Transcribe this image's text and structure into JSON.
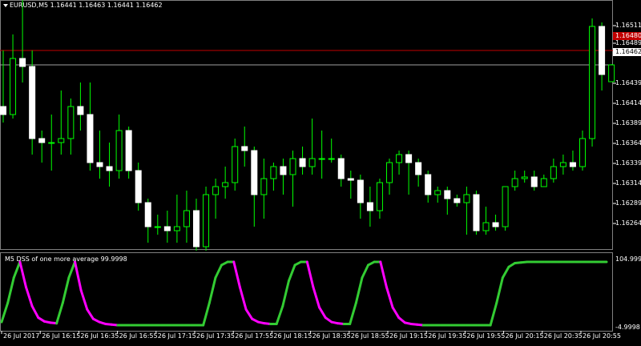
{
  "header": {
    "symbol": "EURUSD,M5",
    "ohlc": "1.16441 1.16463 1.16441 1.16462"
  },
  "price_axis": {
    "labels": [
      "1.16511",
      "1.16489",
      "1.16439",
      "1.16414",
      "1.16389",
      "1.16364",
      "1.16339",
      "1.16314",
      "1.16289",
      "1.16264"
    ],
    "red_level": "1.16480",
    "bid": "1.16462"
  },
  "indicator": {
    "title": "M5 DSS of one more average 99.9998",
    "max_label": "104.9998",
    "min_label": "-4.9998"
  },
  "time_axis": {
    "labels": [
      "26 Jul 2017",
      "26 Jul 16:15",
      "26 Jul 16:35",
      "26 Jul 16:55",
      "26 Jul 17:15",
      "26 Jul 17:35",
      "26 Jul 17:55",
      "26 Jul 18:15",
      "26 Jul 18:35",
      "26 Jul 18:55",
      "26 Jul 19:15",
      "26 Jul 19:35",
      "26 Jul 19:55",
      "26 Jul 20:15",
      "26 Jul 20:35",
      "26 Jul 20:55"
    ]
  },
  "colors": {
    "background": "#000000",
    "bull": "#00ff00",
    "bear_body": "#ffffff",
    "red_line": "#c00000",
    "dss_up": "#33cc33",
    "dss_down": "#ff00ff",
    "grid": "#808080"
  },
  "chart_data": [
    {
      "type": "candlestick",
      "title": "EURUSD,M5",
      "y_ticks": [
        1.16511,
        1.16489,
        1.16439,
        1.16414,
        1.16389,
        1.16364,
        1.16339,
        1.16314,
        1.16289,
        1.16264
      ],
      "levels": {
        "red": 1.1648,
        "bid": 1.16462
      },
      "candles": [
        {
          "o": 1.1641,
          "h": 1.1648,
          "l": 1.1639,
          "c": 1.164
        },
        {
          "o": 1.164,
          "h": 1.165,
          "l": 1.16395,
          "c": 1.1647
        },
        {
          "o": 1.1647,
          "h": 1.1656,
          "l": 1.1644,
          "c": 1.1646
        },
        {
          "o": 1.1646,
          "h": 1.1648,
          "l": 1.1635,
          "c": 1.1637
        },
        {
          "o": 1.1637,
          "h": 1.1638,
          "l": 1.1634,
          "c": 1.16365
        },
        {
          "o": 1.16365,
          "h": 1.164,
          "l": 1.1633,
          "c": 1.16365
        },
        {
          "o": 1.16365,
          "h": 1.1643,
          "l": 1.1635,
          "c": 1.1637
        },
        {
          "o": 1.1637,
          "h": 1.1642,
          "l": 1.1635,
          "c": 1.1641
        },
        {
          "o": 1.1641,
          "h": 1.1644,
          "l": 1.1638,
          "c": 1.164
        },
        {
          "o": 1.164,
          "h": 1.1644,
          "l": 1.1633,
          "c": 1.1634
        },
        {
          "o": 1.1634,
          "h": 1.1638,
          "l": 1.1632,
          "c": 1.16335
        },
        {
          "o": 1.16335,
          "h": 1.16365,
          "l": 1.1631,
          "c": 1.1633
        },
        {
          "o": 1.1633,
          "h": 1.164,
          "l": 1.1632,
          "c": 1.1638
        },
        {
          "o": 1.1638,
          "h": 1.16385,
          "l": 1.1632,
          "c": 1.1633
        },
        {
          "o": 1.1633,
          "h": 1.1634,
          "l": 1.1628,
          "c": 1.1629
        },
        {
          "o": 1.1629,
          "h": 1.16295,
          "l": 1.1624,
          "c": 1.1626
        },
        {
          "o": 1.1626,
          "h": 1.16275,
          "l": 1.1625,
          "c": 1.1626
        },
        {
          "o": 1.1626,
          "h": 1.1628,
          "l": 1.1624,
          "c": 1.16255
        },
        {
          "o": 1.16255,
          "h": 1.163,
          "l": 1.1624,
          "c": 1.1626
        },
        {
          "o": 1.1626,
          "h": 1.16305,
          "l": 1.1624,
          "c": 1.1628
        },
        {
          "o": 1.1628,
          "h": 1.16295,
          "l": 1.1623,
          "c": 1.16235
        },
        {
          "o": 1.16235,
          "h": 1.1631,
          "l": 1.1623,
          "c": 1.163
        },
        {
          "o": 1.163,
          "h": 1.1632,
          "l": 1.1627,
          "c": 1.1631
        },
        {
          "o": 1.1631,
          "h": 1.16335,
          "l": 1.16295,
          "c": 1.16315
        },
        {
          "o": 1.16315,
          "h": 1.1637,
          "l": 1.16305,
          "c": 1.1636
        },
        {
          "o": 1.1636,
          "h": 1.16385,
          "l": 1.16335,
          "c": 1.16355
        },
        {
          "o": 1.16355,
          "h": 1.1636,
          "l": 1.1626,
          "c": 1.163
        },
        {
          "o": 1.163,
          "h": 1.16345,
          "l": 1.1627,
          "c": 1.1632
        },
        {
          "o": 1.1632,
          "h": 1.1634,
          "l": 1.16305,
          "c": 1.16335
        },
        {
          "o": 1.16335,
          "h": 1.16345,
          "l": 1.163,
          "c": 1.16325
        },
        {
          "o": 1.16325,
          "h": 1.16355,
          "l": 1.16285,
          "c": 1.16345
        },
        {
          "o": 1.16345,
          "h": 1.1636,
          "l": 1.16325,
          "c": 1.16335
        },
        {
          "o": 1.16335,
          "h": 1.16395,
          "l": 1.16325,
          "c": 1.16345
        },
        {
          "o": 1.16345,
          "h": 1.1638,
          "l": 1.1632,
          "c": 1.16345
        },
        {
          "o": 1.16345,
          "h": 1.1637,
          "l": 1.1634,
          "c": 1.16345
        },
        {
          "o": 1.16345,
          "h": 1.1635,
          "l": 1.1631,
          "c": 1.1632
        },
        {
          "o": 1.1632,
          "h": 1.1633,
          "l": 1.16295,
          "c": 1.16318
        },
        {
          "o": 1.16318,
          "h": 1.16325,
          "l": 1.1627,
          "c": 1.1629
        },
        {
          "o": 1.1629,
          "h": 1.1631,
          "l": 1.1626,
          "c": 1.1628
        },
        {
          "o": 1.1628,
          "h": 1.1632,
          "l": 1.1627,
          "c": 1.16315
        },
        {
          "o": 1.16315,
          "h": 1.16345,
          "l": 1.163,
          "c": 1.1634
        },
        {
          "o": 1.1634,
          "h": 1.16355,
          "l": 1.16325,
          "c": 1.1635
        },
        {
          "o": 1.1635,
          "h": 1.16355,
          "l": 1.163,
          "c": 1.1634
        },
        {
          "o": 1.1634,
          "h": 1.16345,
          "l": 1.1631,
          "c": 1.16325
        },
        {
          "o": 1.16325,
          "h": 1.1633,
          "l": 1.1629,
          "c": 1.163
        },
        {
          "o": 1.163,
          "h": 1.1631,
          "l": 1.1629,
          "c": 1.16305
        },
        {
          "o": 1.16305,
          "h": 1.1631,
          "l": 1.16275,
          "c": 1.16295
        },
        {
          "o": 1.16295,
          "h": 1.163,
          "l": 1.16285,
          "c": 1.1629
        },
        {
          "o": 1.1629,
          "h": 1.1631,
          "l": 1.1625,
          "c": 1.163
        },
        {
          "o": 1.163,
          "h": 1.16305,
          "l": 1.1625,
          "c": 1.16255
        },
        {
          "o": 1.16255,
          "h": 1.16285,
          "l": 1.1625,
          "c": 1.16265
        },
        {
          "o": 1.16265,
          "h": 1.16275,
          "l": 1.16255,
          "c": 1.1626
        },
        {
          "o": 1.1626,
          "h": 1.1631,
          "l": 1.16255,
          "c": 1.1631
        },
        {
          "o": 1.1631,
          "h": 1.1633,
          "l": 1.16305,
          "c": 1.1632
        },
        {
          "o": 1.1632,
          "h": 1.1633,
          "l": 1.16315,
          "c": 1.16322
        },
        {
          "o": 1.16322,
          "h": 1.1633,
          "l": 1.16305,
          "c": 1.1631
        },
        {
          "o": 1.1631,
          "h": 1.16325,
          "l": 1.1631,
          "c": 1.1632
        },
        {
          "o": 1.1632,
          "h": 1.16345,
          "l": 1.16315,
          "c": 1.16335
        },
        {
          "o": 1.16335,
          "h": 1.1635,
          "l": 1.16325,
          "c": 1.1634
        },
        {
          "o": 1.1634,
          "h": 1.16355,
          "l": 1.1633,
          "c": 1.16335
        },
        {
          "o": 1.16335,
          "h": 1.1638,
          "l": 1.1633,
          "c": 1.1637
        },
        {
          "o": 1.1637,
          "h": 1.1652,
          "l": 1.1636,
          "c": 1.1651
        },
        {
          "o": 1.1651,
          "h": 1.16515,
          "l": 1.1643,
          "c": 1.1645
        },
        {
          "o": 1.16441,
          "h": 1.16463,
          "l": 1.16441,
          "c": 1.16462
        }
      ]
    },
    {
      "type": "line",
      "title": "M5 DSS of one more average 99.9998",
      "ylim": [
        -4.9998,
        104.9998
      ],
      "values": [
        5,
        35,
        75,
        100,
        60,
        30,
        12,
        6,
        4,
        3,
        35,
        75,
        100,
        55,
        25,
        10,
        5,
        2,
        1,
        0,
        0,
        0,
        0,
        0,
        0,
        0,
        0,
        0,
        0,
        0,
        0,
        0,
        0,
        0,
        35,
        75,
        95,
        100,
        100,
        60,
        25,
        10,
        5,
        3,
        2,
        2,
        30,
        70,
        95,
        100,
        100,
        60,
        28,
        12,
        5,
        3,
        2,
        2,
        35,
        75,
        95,
        100,
        100,
        60,
        28,
        12,
        4,
        2,
        1,
        0,
        0,
        0,
        0,
        0,
        0,
        0,
        0,
        0,
        0,
        0,
        0,
        35,
        75,
        92,
        98,
        99,
        100,
        100,
        100,
        100,
        100,
        100,
        100,
        100,
        100,
        100,
        100,
        100,
        100,
        100
      ]
    }
  ]
}
